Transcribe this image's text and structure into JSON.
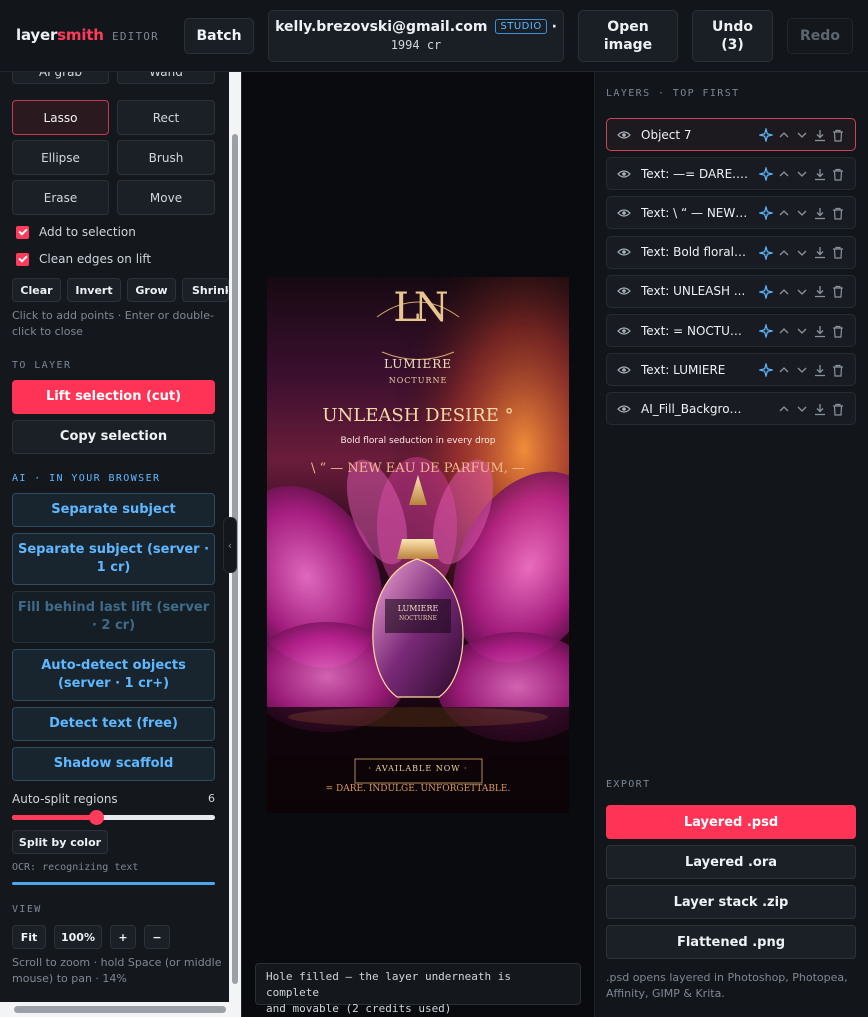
{
  "brand": {
    "part1": "layer",
    "part2": "smith",
    "tag": "EDITOR"
  },
  "topbar": {
    "batch": "Batch",
    "account": {
      "email": "kelly.brezovski@gmail.com",
      "badge": "STUDIO",
      "separator": "·",
      "credits": "1994 cr"
    },
    "open_image": "Open image",
    "undo": "Undo (3)",
    "redo": "Redo"
  },
  "tools": {
    "ai_grab": "AI grab",
    "wand": "Wand",
    "lasso": "Lasso",
    "rect": "Rect",
    "ellipse": "Ellipse",
    "brush": "Brush",
    "erase": "Erase",
    "move": "Move"
  },
  "options": {
    "add_to_selection": "Add to selection",
    "clean_edges": "Clean edges on lift"
  },
  "selection_actions": {
    "clear": "Clear",
    "invert": "Invert",
    "grow": "Grow",
    "shrink": "Shrink"
  },
  "selection_hint": {
    "line1": "Click to add points · Enter or double-",
    "line2": "click to close"
  },
  "to_layer": {
    "title": "TO LAYER",
    "lift": "Lift selection (cut)",
    "copy": "Copy selection"
  },
  "ai": {
    "title": "AI · IN YOUR BROWSER",
    "separate": "Separate subject",
    "separate_server_l1": "Separate subject (server ·",
    "separate_server_l2": "1 cr)",
    "fill_behind_l1": "Fill behind last lift (server",
    "fill_behind_l2": "· 2 cr)",
    "auto_detect_l1": "Auto-detect objects",
    "auto_detect_l2": "(server · 1 cr+)",
    "detect_text": "Detect text (free)",
    "shadow": "Shadow scaffold"
  },
  "auto_split": {
    "label": "Auto-split regions",
    "value": 6,
    "min": 1,
    "max": 20,
    "level": 0.41
  },
  "split_by_color": "Split by color",
  "ocr_status": "OCR: recognizing text",
  "view": {
    "title": "VIEW",
    "fit": "Fit",
    "zoom": "100%",
    "zoom_in": "+",
    "zoom_out": "−",
    "hint_l1": "Scroll to zoom · hold Space (or middle",
    "hint_l2": "mouse) to pan · 14%"
  },
  "poster": {
    "monogram": "LN",
    "brand": "LUMIERE",
    "sub": "NOCTURNE",
    "headline": "UNLEASH DESIRE °",
    "tagline": "Bold floral seduction in every drop",
    "kicker": "\\ “ — NEW EAU DE PARFUM, —",
    "bottle_l1": "LUMIERE",
    "bottle_l2": "NOCTURNE",
    "available": "· AVAILABLE NOW ·",
    "footer": "= DARE. INDULGE. UNFORGETTABLE."
  },
  "toast": {
    "line1": "Hole filled — the layer underneath is complete",
    "line2": "and movable (2 credits used)"
  },
  "layers": {
    "title": "LAYERS · TOP FIRST",
    "items": [
      {
        "name": "Object 7",
        "ai": true
      },
      {
        "name": "Text: —= DARE. I...",
        "ai": true
      },
      {
        "name": "Text: \\ “ — NEW ...",
        "ai": true
      },
      {
        "name": "Text: Bold floral ...",
        "ai": true
      },
      {
        "name": "Text: UNLEASH ...",
        "ai": true
      },
      {
        "name": "Text: = NOCTUR...",
        "ai": true
      },
      {
        "name": "Text: LUMIERE",
        "ai": true
      },
      {
        "name": "AI_Fill_Background",
        "ai": false
      }
    ]
  },
  "export": {
    "title": "EXPORT",
    "psd": "Layered .psd",
    "ora": "Layered .ora",
    "zip": "Layer stack .zip",
    "png": "Flattened .png",
    "note": ".psd opens layered in Photoshop, Photopea, Affinity, GIMP & Krita."
  },
  "colors": {
    "accent": "#ff3355",
    "ai_blue": "#5fb8ff",
    "bg": "#0f1216"
  }
}
